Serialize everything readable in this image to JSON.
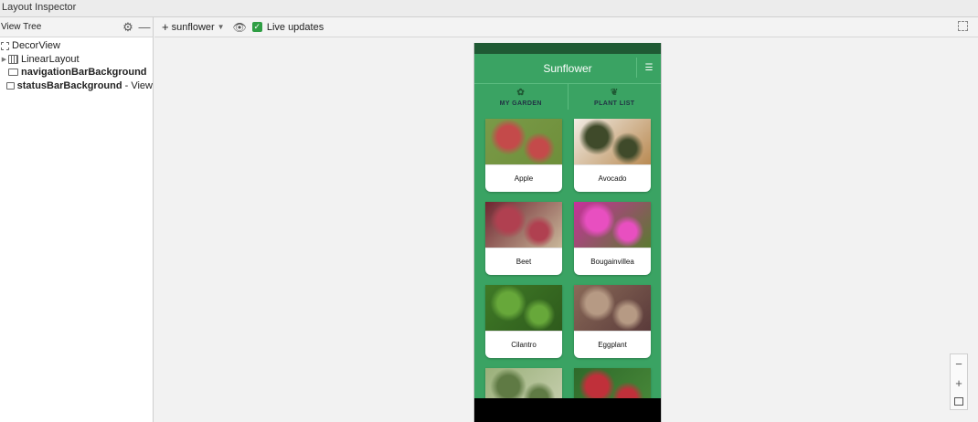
{
  "window": {
    "title": "Layout Inspector"
  },
  "left_panel": {
    "header": "View Tree",
    "settings_icon": "gear-icon",
    "collapse_icon": "minus-icon",
    "tree": [
      {
        "label": "DecorView",
        "suffix": "",
        "bold": false,
        "indent": 0,
        "expandable": false,
        "icon": "decor-icon"
      },
      {
        "label": "LinearLayout",
        "suffix": "",
        "bold": false,
        "indent": 1,
        "expandable": true,
        "icon": "linear-layout-icon"
      },
      {
        "label": "navigationBarBackground",
        "suffix": "",
        "bold": true,
        "indent": 1,
        "expandable": false,
        "icon": "view-icon"
      },
      {
        "label": "statusBarBackground",
        "suffix": " - View",
        "bold": true,
        "indent": 1,
        "expandable": false,
        "icon": "view-icon"
      }
    ]
  },
  "toolbar": {
    "process_prefix": "+",
    "process_label": "sunflower",
    "live_updates_label": "Live updates",
    "live_updates_checked": true
  },
  "device": {
    "app_title": "Sunflower",
    "tabs": [
      {
        "label": "MY GARDEN",
        "icon": "garden-icon"
      },
      {
        "label": "PLANT LIST",
        "icon": "sprout-icon"
      }
    ],
    "plants": [
      {
        "name": "Apple",
        "colors": [
          "#7a9a48",
          "#c44a4a",
          "#6e8f3a"
        ]
      },
      {
        "name": "Avocado",
        "colors": [
          "#f1ece4",
          "#3f4a2a",
          "#b98a52"
        ]
      },
      {
        "name": "Beet",
        "colors": [
          "#6e2430",
          "#b04050",
          "#c9b89a"
        ]
      },
      {
        "name": "Bougainvillea",
        "colors": [
          "#c8309c",
          "#e84fc0",
          "#5a7a30"
        ]
      },
      {
        "name": "Cilantro",
        "colors": [
          "#3f7a26",
          "#67a83a",
          "#2e5a1c"
        ]
      },
      {
        "name": "Eggplant",
        "colors": [
          "#8a6a58",
          "#b69a84",
          "#5a3a3a"
        ]
      },
      {
        "name": "",
        "colors": [
          "#9ab07a",
          "#5f7a44",
          "#c8d0b0"
        ]
      },
      {
        "name": "",
        "colors": [
          "#2e6a2a",
          "#c0303a",
          "#4a8a3a"
        ]
      }
    ]
  },
  "zoom_controls": {
    "zoom_out": "−",
    "zoom_in": "+",
    "fit_icon": "fit-screen-icon"
  }
}
